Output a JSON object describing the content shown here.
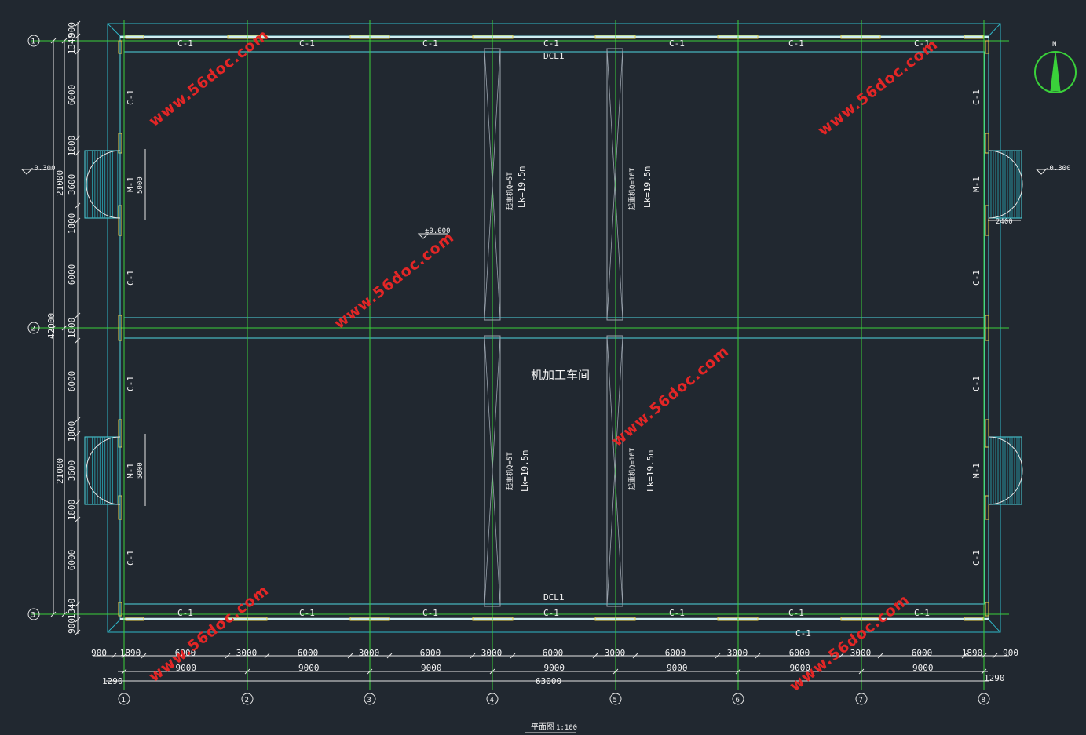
{
  "drawing": {
    "room_name": "机加工车间",
    "caption": "平面图",
    "scale": "1:100",
    "level_outside": "-0.300",
    "level_inside": "±0.000",
    "north_label": "N",
    "beam_label": "DCL1",
    "beam_label_bottom": "DCL1",
    "window_label": "C-1",
    "door_label": "M-1",
    "door_width_label": "5000",
    "ramp_width_label": "2400",
    "crane_left_top": "起重机Q=5T",
    "crane_left_top_span": "Lk=19.5m",
    "crane_right_top": "起重机Q=10T",
    "crane_right_top_span": "Lk=19.5m",
    "crane_left_bottom": "起重机Q=5T",
    "crane_left_bottom_span": "Lk=19.5m",
    "crane_right_bottom": "起重机Q=10T",
    "crane_right_bottom_span": "Lk=19.5m",
    "watermark": "www.56doc.com"
  },
  "axes_vertical": [
    "1",
    "2",
    "3",
    "4",
    "5",
    "6",
    "7",
    "8"
  ],
  "axes_horizontal": [
    "1",
    "2",
    "3"
  ],
  "dims_bottom_row1": [
    "900",
    "1890",
    "6000",
    "3000",
    "6000",
    "3000",
    "6000",
    "3000",
    "6000",
    "3000",
    "6000",
    "3000",
    "6000",
    "3000",
    "6000",
    "1890",
    "900"
  ],
  "dims_bottom_row2": [
    "9000",
    "9000",
    "9000",
    "9000",
    "9000",
    "9000",
    "9000"
  ],
  "dims_bottom_total": "63000",
  "dims_bottom_edge": "1290",
  "dims_left_row1": [
    "900",
    "1340",
    "6000",
    "1800",
    "3600",
    "1800",
    "6000",
    "1800",
    "6000",
    "1800",
    "3600",
    "1800",
    "6000",
    "1340",
    "900"
  ],
  "dims_left_row2": [
    "21000",
    "21000"
  ],
  "dims_left_total": "42000",
  "colors": {
    "background": "#212830",
    "axis_line": "#3ad13a",
    "wall_line": "#4fd6e0",
    "outer_line": "#2fb7c8",
    "column": "#e8d04a",
    "watermark": "#e32626",
    "text": "#f2f2f2",
    "crane": "#9aa3ad"
  }
}
